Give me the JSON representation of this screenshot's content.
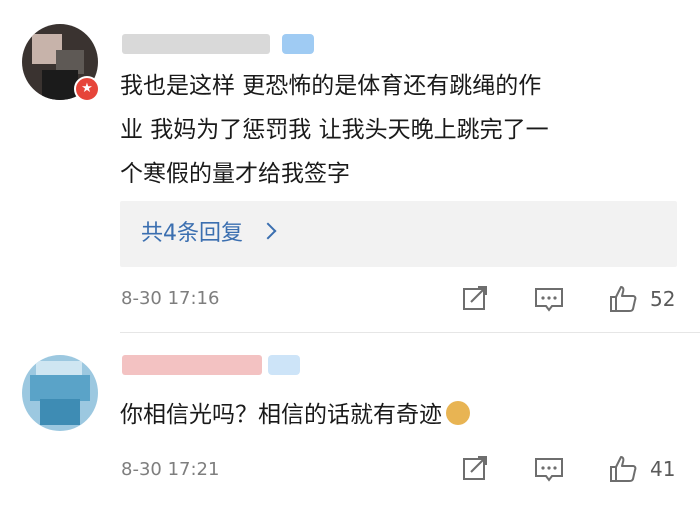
{
  "comments": [
    {
      "text_lines": [
        "我也是这样 更恐怖的是体育还有跳绳的作",
        "业 我妈为了惩罚我 让我头天晚上跳完了一",
        "个寒假的量才给我签字"
      ],
      "replies_label": "共4条回复",
      "time": "8-30 17:16",
      "likes": "52",
      "badge_icon": "star-icon"
    },
    {
      "text": "你相信光吗？相信的话就有奇迹",
      "emoji": "doge-emoji",
      "time": "8-30 17:21",
      "likes": "41",
      "badge_icon": "verified-check-icon"
    }
  ],
  "colors": {
    "link": "#3b6fb0",
    "text": "#1a1a1a",
    "meta": "#7e7e7e",
    "reply_bg": "#f2f2f2",
    "badge_red": "#e6453a",
    "badge_gold": "#f6b11a"
  }
}
